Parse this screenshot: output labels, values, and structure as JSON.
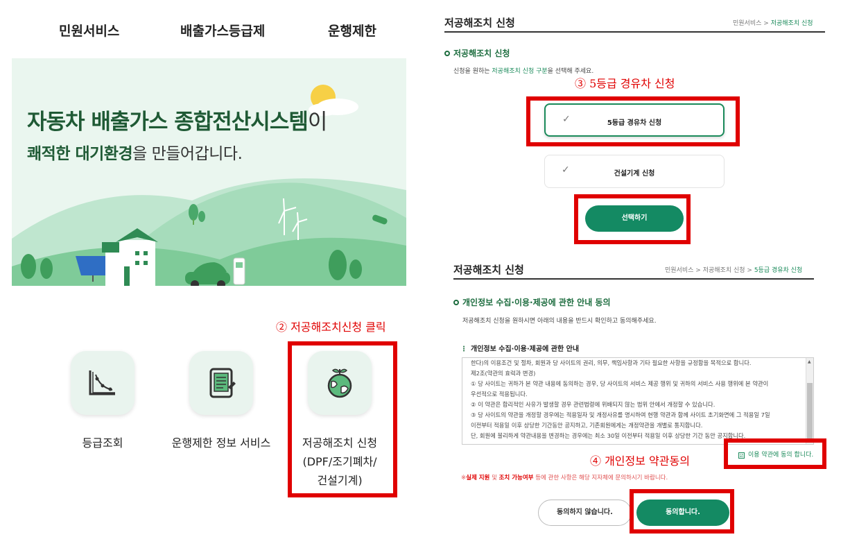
{
  "left": {
    "nav": [
      "민원서비스",
      "배출가스등급제",
      "운행제한"
    ],
    "hero": {
      "title_bold": "자동차 배출가스 종합전산시스템",
      "title_tail": "이",
      "sub_bold": "쾌적한 대기환경",
      "sub_tail": "을 만들어갑니다."
    },
    "step2": "② 저공해조치신청 클릭",
    "services": [
      {
        "icon": "graph-chart-icon",
        "label": "등급조회"
      },
      {
        "icon": "tablet-document-icon",
        "label": "운행제한 정보 서비스"
      },
      {
        "icon": "globe-sprout-icon",
        "label_lines": [
          "저공해조치 신청",
          "(DPF/조기폐차/",
          "건설기계)"
        ]
      }
    ]
  },
  "right_top": {
    "title": "저공해조치 신청",
    "breadcrumb": [
      "민원서비스",
      ">",
      "저공해조치 신청"
    ],
    "section_title": "저공해조치 신청",
    "desc_pre": "신청을 원하는 ",
    "desc_hl": "저공해조치 신청 구분",
    "desc_post": "을 선택해 주세요.",
    "step3": "③ 5등급 경유차 신청",
    "options": [
      {
        "check": "✓",
        "label": "5등급 경유차 신청",
        "selected": true
      },
      {
        "check": "✓",
        "label": "건설기계 신청",
        "selected": false
      }
    ],
    "select_button": "선택하기"
  },
  "right_bottom": {
    "title": "저공해조치 신청",
    "breadcrumb": [
      "민원서비스",
      ">",
      "저공해조치 신청",
      ">",
      "5등급 경유차 신청"
    ],
    "section_title": "개인정보 수집·이용·제공에 관한 안내 동의",
    "desc": "저공해조치 신청을 원하시면 아래의 내용을 반드시 확인하고 동의해주세요.",
    "terms_heading": "개인정보 수집·이용·제공에 관한 안내",
    "terms_lines": [
      "한다)의 이용조건 및 절차, 회원과 당 사이트의 권리, 의무, 책임사항과 기타 필요한 사항을 규정함을 목적으로 합니다.",
      "제2조(약관의 효력과 변경)",
      "① 당 사이트는 귀하가 본 약관 내용에 동의하는 경우, 당 사이트의 서비스 제공 행위 및 귀하의 서비스 사용 행위에 본 약관이",
      "우선적으로 적용됩니다.",
      "② 이 약관은 합리적인 사유가 발생할 경우 관련법령에 위배되지 않는 범위 안에서 개정할 수 있습니다.",
      "③ 당 사이트의 약관을 개정할 경우에는 적용일자 및 개정사유를 명시하여 현행 약관과 함께 사이트 초기화면에 그 적용일 7일",
      "이전부터 적용일 이후 상당한 기간동안 공지하고, 기존회원에게는 개정약관을 개별로 통지합니다.",
      "단, 회원에 불리하게 약관내용을 변경하는 경우에는 최소 30일 이전부터 적용일 이후 상당한 기간 동안 공지합니다."
    ],
    "agree_check": "☑",
    "agree_label": "이용 약관에 동의 합니다.",
    "step4": "④ 개인정보 약관동의",
    "notice_pre": "※",
    "notice_b1": "실제 지원",
    "notice_mid1": " 및 ",
    "notice_b2": "조치 가능여부",
    "notice_post": " 등에 관한 사항은 해당 지자체에 문의하시기 바랍니다.",
    "disagree_button": "동의하지 않습니다.",
    "agree_button": "동의합니다."
  },
  "colors": {
    "accent": "#148a63",
    "highlight": "#e00000",
    "heading": "#1d6d3f"
  }
}
